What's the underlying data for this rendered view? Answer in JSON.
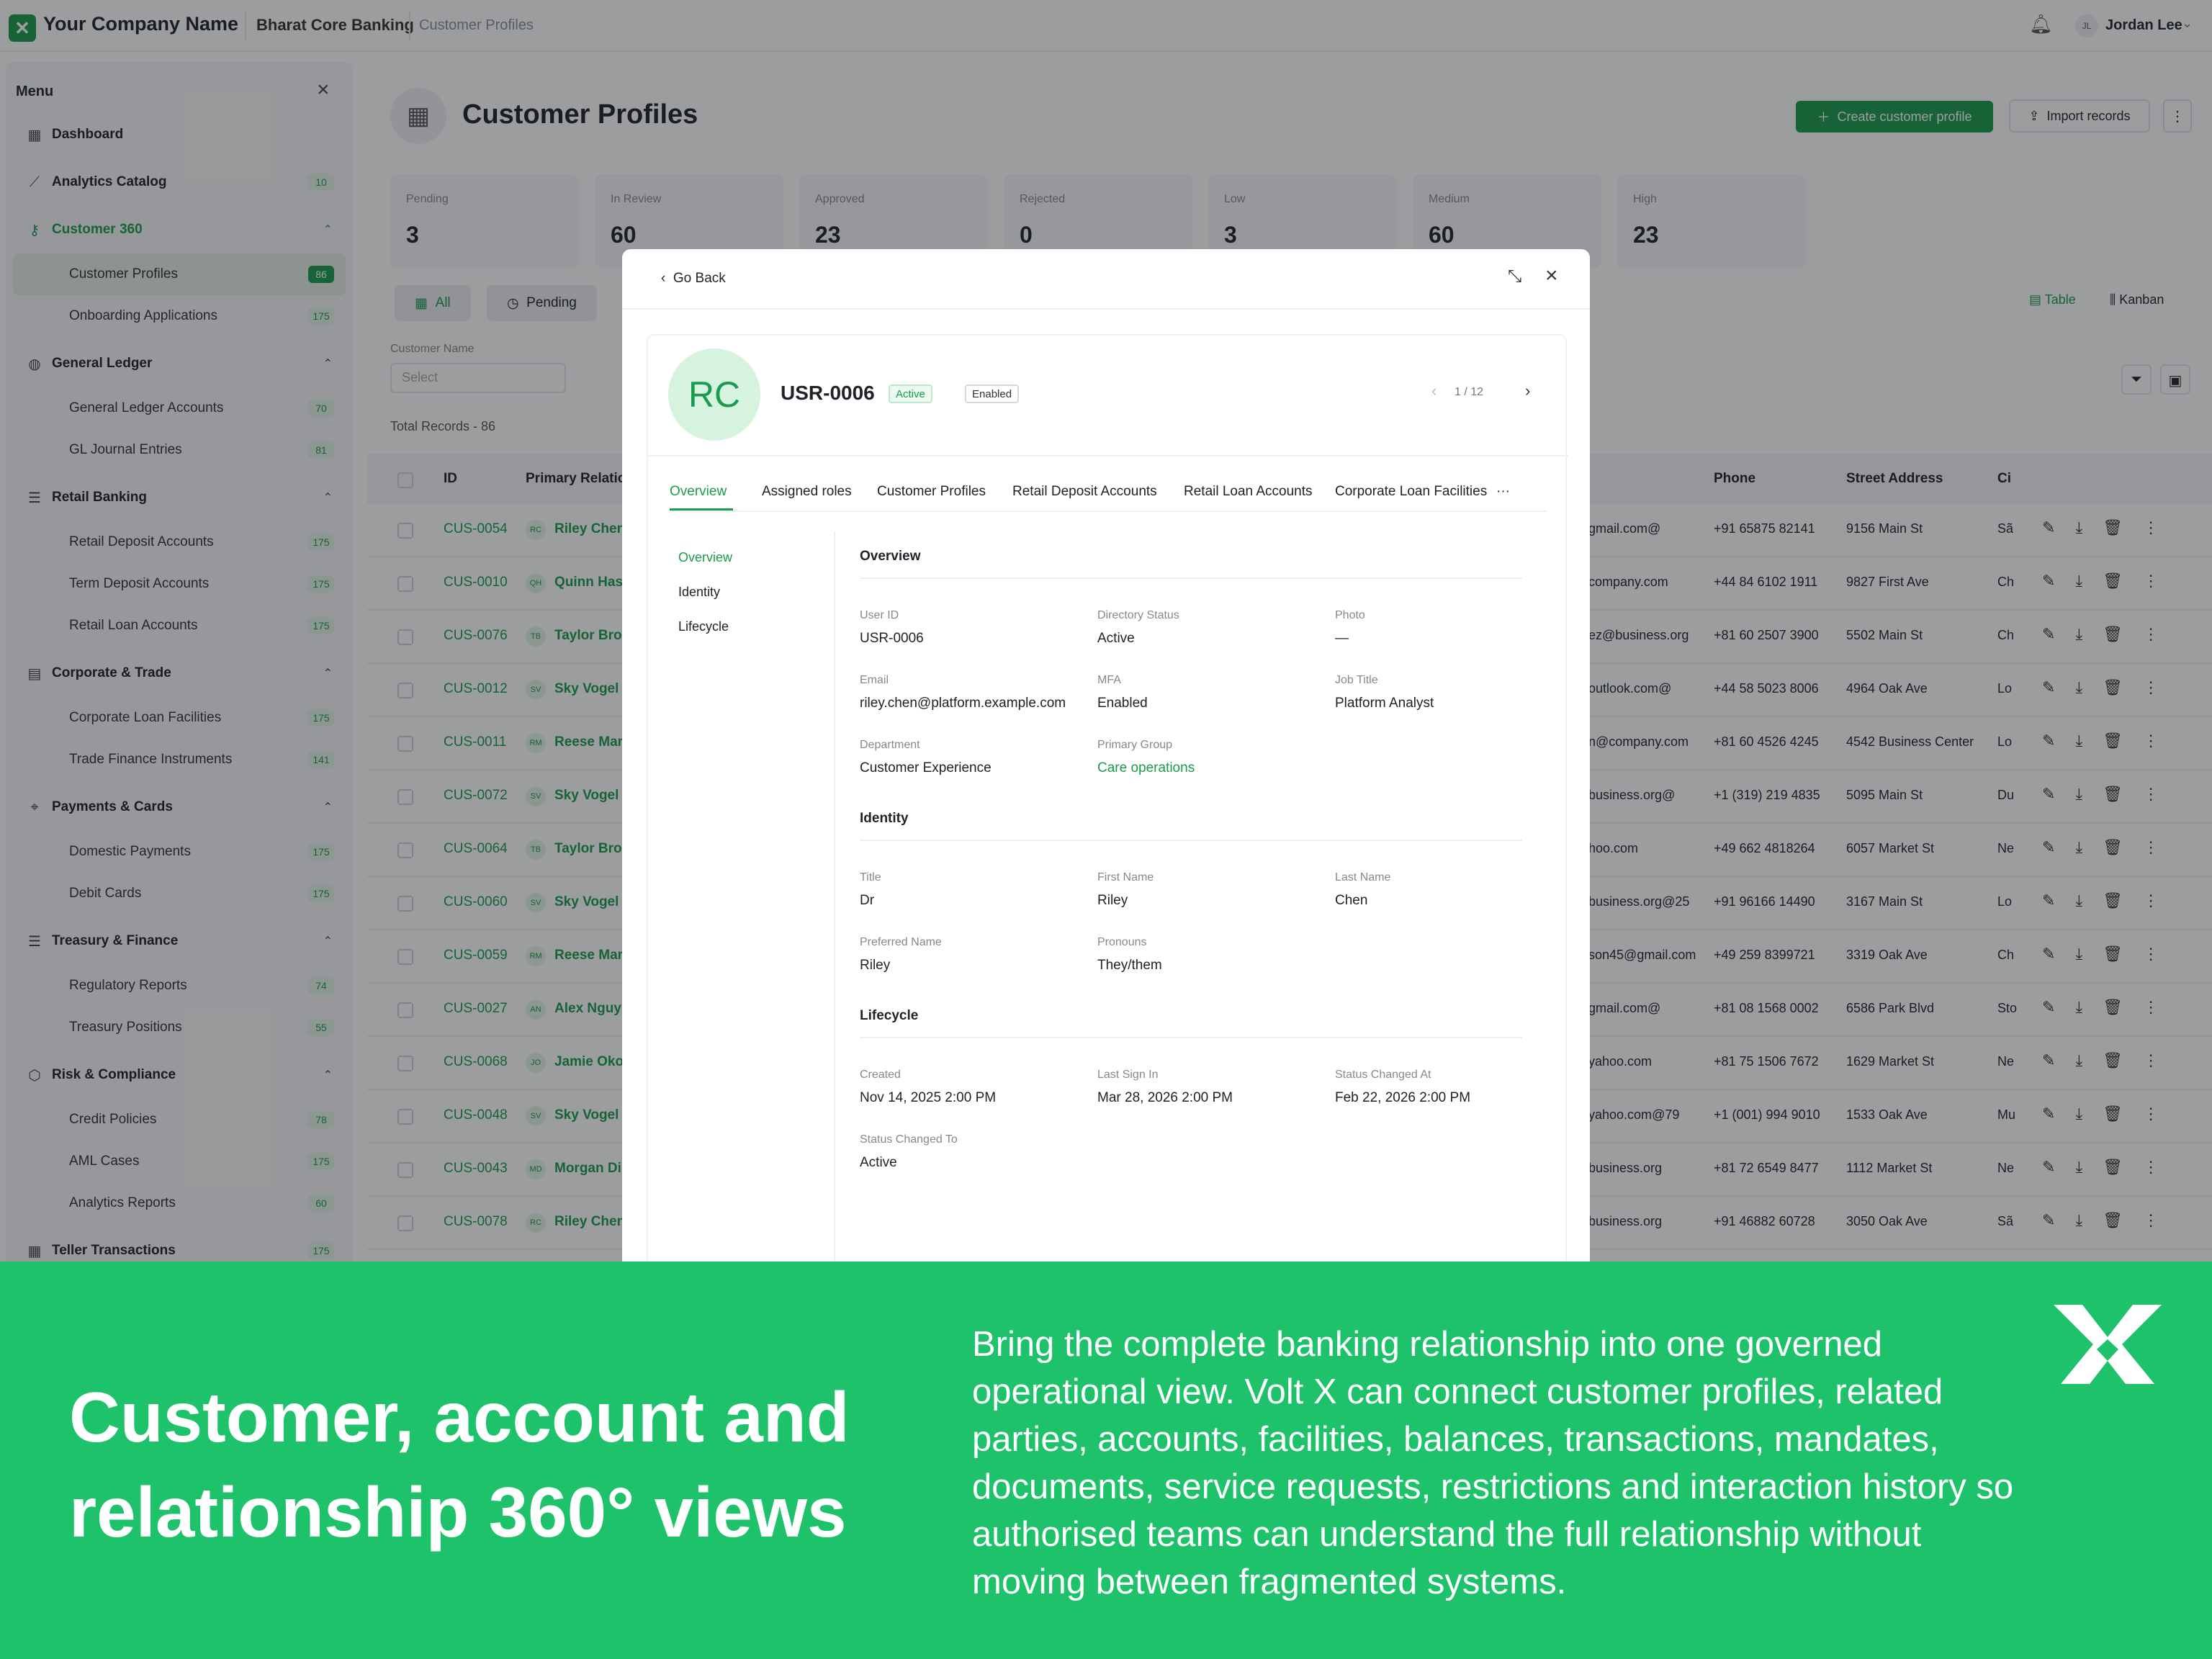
{
  "app": {
    "company": "Your Company Name",
    "product": "Bharat Core Banking",
    "breadcrumb": "Customer Profiles",
    "user_initials": "JL",
    "user_name": "Jordan Lee"
  },
  "sidebar": {
    "title": "Menu",
    "items": [
      {
        "label": "Dashboard",
        "icon": "grid-icon",
        "type": "top"
      },
      {
        "label": "Analytics Catalog",
        "icon": "chart-icon",
        "type": "top",
        "badge": "10"
      },
      {
        "label": "Customer 360",
        "icon": "key-icon",
        "type": "group"
      },
      {
        "label": "Customer Profiles",
        "type": "sub",
        "badge": "86",
        "active": true
      },
      {
        "label": "Onboarding Applications",
        "type": "sub",
        "badge": "175"
      },
      {
        "label": "General Ledger",
        "icon": "globe-icon",
        "type": "group"
      },
      {
        "label": "General Ledger Accounts",
        "type": "sub",
        "badge": "70"
      },
      {
        "label": "GL Journal Entries",
        "type": "sub",
        "badge": "81"
      },
      {
        "label": "Retail Banking",
        "icon": "list-icon",
        "type": "group"
      },
      {
        "label": "Retail Deposit Accounts",
        "type": "sub",
        "badge": "175"
      },
      {
        "label": "Term Deposit Accounts",
        "type": "sub",
        "badge": "175"
      },
      {
        "label": "Retail Loan Accounts",
        "type": "sub",
        "badge": "175"
      },
      {
        "label": "Corporate & Trade",
        "icon": "clipboard-icon",
        "type": "group"
      },
      {
        "label": "Corporate Loan Facilities",
        "type": "sub",
        "badge": "175"
      },
      {
        "label": "Trade Finance Instruments",
        "type": "sub",
        "badge": "141"
      },
      {
        "label": "Payments & Cards",
        "icon": "pin-icon",
        "type": "group"
      },
      {
        "label": "Domestic Payments",
        "type": "sub",
        "badge": "175"
      },
      {
        "label": "Debit Cards",
        "type": "sub",
        "badge": "175"
      },
      {
        "label": "Treasury & Finance",
        "icon": "list-icon",
        "type": "group"
      },
      {
        "label": "Regulatory Reports",
        "type": "sub",
        "badge": "74"
      },
      {
        "label": "Treasury Positions",
        "type": "sub",
        "badge": "55"
      },
      {
        "label": "Risk & Compliance",
        "icon": "box-icon",
        "type": "group"
      },
      {
        "label": "Credit Policies",
        "type": "sub",
        "badge": "78"
      },
      {
        "label": "AML Cases",
        "type": "sub",
        "badge": "175"
      },
      {
        "label": "Analytics Reports",
        "type": "sub",
        "badge": "60"
      },
      {
        "label": "Teller Transactions",
        "icon": "grid-icon",
        "type": "top",
        "badge": "175"
      }
    ]
  },
  "page": {
    "title": "Customer Profiles",
    "create_label": "Create customer profile",
    "import_label": "Import records",
    "stats": [
      {
        "label": "Pending",
        "value": "3"
      },
      {
        "label": "In Review",
        "value": "60"
      },
      {
        "label": "Approved",
        "value": "23"
      },
      {
        "label": "Rejected",
        "value": "0"
      },
      {
        "label": "Low",
        "value": "3"
      },
      {
        "label": "Medium",
        "value": "60"
      },
      {
        "label": "High",
        "value": "23"
      }
    ],
    "filters": {
      "all": "All",
      "pending": "Pending",
      "customer_name_label": "Customer Name",
      "select_placeholder": "Select"
    },
    "total_records": "Total Records - 86",
    "views": {
      "table": "Table",
      "kanban": "Kanban"
    },
    "columns": {
      "id": "ID",
      "primary": "Primary Relatio",
      "phone": "Phone",
      "street": "Street Address",
      "city": "Ci"
    },
    "rows": [
      {
        "id": "CUS-0054",
        "init": "RC",
        "name": "Riley Chen",
        "email": "@gmail.com",
        "phone": "+91 65875 82141",
        "street": "9156 Main St",
        "city": "Sã"
      },
      {
        "id": "CUS-0010",
        "init": "QH",
        "name": "Quinn Has",
        "email": "company.com",
        "phone": "+44 84 6102 1911",
        "street": "9827 First Ave",
        "city": "Ch"
      },
      {
        "id": "CUS-0076",
        "init": "TB",
        "name": "Taylor Bro",
        "email": "ez@business.org",
        "phone": "+81 60 2507 3900",
        "street": "5502 Main St",
        "city": "Ch"
      },
      {
        "id": "CUS-0012",
        "init": "SV",
        "name": "Sky Vogel",
        "email": "@outlook.com",
        "phone": "+44 58 5023 8006",
        "street": "4964 Oak Ave",
        "city": "Lo"
      },
      {
        "id": "CUS-0011",
        "init": "RM",
        "name": "Reese Mar",
        "email": "n@company.com",
        "phone": "+81 60 4526 4245",
        "street": "4542 Business Center",
        "city": "Lo"
      },
      {
        "id": "CUS-0072",
        "init": "SV",
        "name": "Sky Vogel",
        "email": "@business.org",
        "phone": "+1 (319) 219 4835",
        "street": "5095 Main St",
        "city": "Du"
      },
      {
        "id": "CUS-0064",
        "init": "TB",
        "name": "Taylor Bro",
        "email": "hoo.com",
        "phone": "+49 662 4818264",
        "street": "6057 Market St",
        "city": "Ne"
      },
      {
        "id": "CUS-0060",
        "init": "SV",
        "name": "Sky Vogel",
        "email": "25@business.org",
        "phone": "+91 96166 14490",
        "street": "3167 Main St",
        "city": "Lo"
      },
      {
        "id": "CUS-0059",
        "init": "RM",
        "name": "Reese Mar",
        "email": "son45@gmail.com",
        "phone": "+49 259 8399721",
        "street": "3319 Oak Ave",
        "city": "Ch"
      },
      {
        "id": "CUS-0027",
        "init": "AN",
        "name": "Alex Nguy",
        "email": "@gmail.com",
        "phone": "+81 08 1568 0002",
        "street": "6586 Park Blvd",
        "city": "Sto"
      },
      {
        "id": "CUS-0068",
        "init": "JO",
        "name": "Jamie Oko",
        "email": "yahoo.com",
        "phone": "+81 75 1506 7672",
        "street": "1629 Market St",
        "city": "Ne"
      },
      {
        "id": "CUS-0048",
        "init": "SV",
        "name": "Sky Vogel",
        "email": "79@yahoo.com",
        "phone": "+1 (001) 994 9010",
        "street": "1533 Oak Ave",
        "city": "Mu"
      },
      {
        "id": "CUS-0043",
        "init": "MD",
        "name": "Morgan Di",
        "email": "business.org",
        "phone": "+81 72 6549 8477",
        "street": "1112 Market St",
        "city": "Ne"
      },
      {
        "id": "CUS-0078",
        "init": "RC",
        "name": "Riley Chen",
        "email": "business.org",
        "phone": "+91 46882 60728",
        "street": "3050 Oak Ave",
        "city": "Sã"
      }
    ]
  },
  "modal": {
    "go_back": "Go Back",
    "avatar": "RC",
    "user_id": "USR-0006",
    "badge_active": "Active",
    "badge_enabled": "Enabled",
    "pager": "1 / 12",
    "tabs": [
      "Overview",
      "Assigned roles",
      "Customer Profiles",
      "Retail Deposit Accounts",
      "Retail Loan Accounts",
      "Corporate Loan Facilities",
      "···"
    ],
    "side": [
      "Overview",
      "Identity",
      "Lifecycle"
    ],
    "sections": {
      "overview": "Overview",
      "identity": "Identity",
      "lifecycle": "Lifecycle"
    },
    "fields": {
      "user_id": {
        "label": "User ID",
        "value": "USR-0006"
      },
      "dir_status": {
        "label": "Directory Status",
        "value": "Active"
      },
      "photo": {
        "label": "Photo",
        "value": "—"
      },
      "email": {
        "label": "Email",
        "value": "riley.chen@platform.example.com"
      },
      "mfa": {
        "label": "MFA",
        "value": "Enabled"
      },
      "job": {
        "label": "Job Title",
        "value": "Platform Analyst"
      },
      "dept": {
        "label": "Department",
        "value": "Customer Experience"
      },
      "group": {
        "label": "Primary Group",
        "value": "Care operations"
      },
      "title": {
        "label": "Title",
        "value": "Dr"
      },
      "first": {
        "label": "First Name",
        "value": "Riley"
      },
      "last": {
        "label": "Last Name",
        "value": "Chen"
      },
      "pref": {
        "label": "Preferred Name",
        "value": "Riley"
      },
      "pron": {
        "label": "Pronouns",
        "value": "They/them"
      },
      "created": {
        "label": "Created",
        "value": "Nov 14, 2025 2:00 PM"
      },
      "signin": {
        "label": "Last Sign In",
        "value": "Mar 28, 2026 2:00 PM"
      },
      "changed_at": {
        "label": "Status Changed At",
        "value": "Feb 22, 2026 2:00 PM"
      },
      "changed_to": {
        "label": "Status Changed To",
        "value": "Active"
      }
    }
  },
  "banner": {
    "headline": "Customer, account and relationship 360° views",
    "body": "Bring the complete banking relationship into one governed operational view. Volt X can connect customer profiles, related parties, accounts, facilities, balances, transactions, mandates, documents, service requests, restrictions and interaction history so authorised teams can understand the full relationship without moving between fragmented systems.",
    "accent": "#1dc26a"
  }
}
